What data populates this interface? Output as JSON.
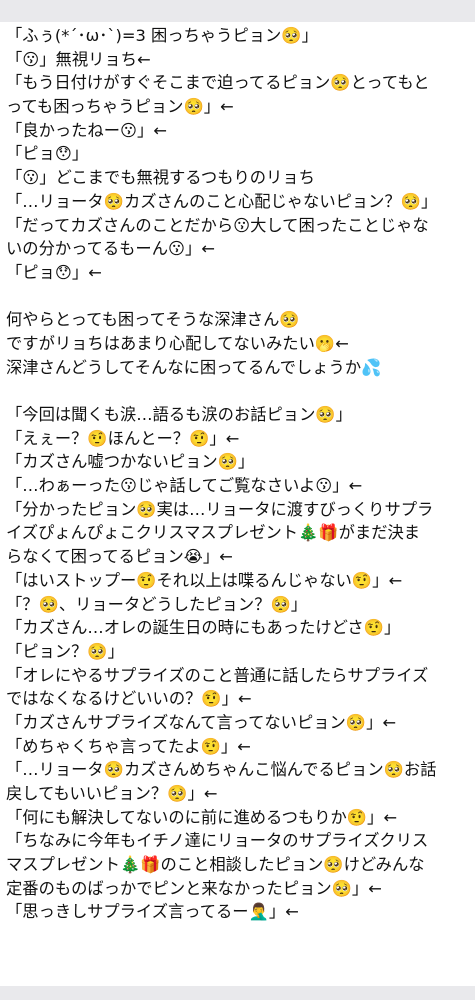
{
  "lines": [
    "「ふぅ(*´･ω･`)=3 困っちゃうピョン🥺」",
    "「😗」無視リョち←",
    "「もう日付けがすぐそこまで迫ってるピョン🥺とってもと",
    "っても困っちゃうピョン🥺」←",
    "「良かったねー😗」←",
    "「ピョ😯」",
    "「😗」どこまでも無視するつもりのリョち",
    "「…リョータ🥺カズさんのこと心配じゃないピョン？🥺」",
    "「だってカズさんのことだから😗大して困ったことじゃな",
    "いの分かってるもーん😗」←",
    "「ピョ😯」←",
    "",
    "何やらとっても困ってそうな深津さん🥺",
    "ですがリョちはあまり心配してないみたい🫢←",
    "深津さんどうしてそんなに困ってるんでしょうか💦",
    "",
    "「今回は聞くも涙…語るも涙のお話ピョン🥺」",
    "「えぇー？🤨ほんとー？🤨」←",
    "「カズさん嘘つかないピョン🥺」",
    "「…わぁーった😗じゃ話してご覧なさいよ😗」←",
    "「分かったピョン🥺実は…リョータに渡すびっくりサプラ",
    "イズぴょんぴょこクリスマスプレゼント🎄🎁がまだ決ま",
    "らなくて困ってるピョン😭」←",
    "「はいストップー🤨それ以上は喋るんじゃない🤨」←",
    "「？🥺、リョータどうしたピョン？🥺」",
    "「カズさん…オレの誕生日の時にもあったけどさ🤨」",
    "「ピョン？🥺」",
    "「オレにやるサプライズのこと普通に話したらサプライズ",
    "ではなくなるけどいいの？🤨」←",
    "「カズさんサプライズなんて言ってないピョン🥺」←",
    "「めちゃくちゃ言ってたよ🤨」←",
    "「…リョータ🥺カズさんめちゃんこ悩んでるピョン🥺お話",
    "戻してもいいピョン？🥺」←",
    "「何にも解決してないのに前に進めるつもりか🤨」←",
    "「ちなみに今年もイチノ達にリョータのサプライズクリス",
    "マスプレゼント🎄🎁のこと相談したピョン🥺けどみんな",
    "定番のものばっかでピンと来なかったピョン🥺」←",
    "「思っきしサプライズ言ってるー🤦‍♂️」←"
  ]
}
